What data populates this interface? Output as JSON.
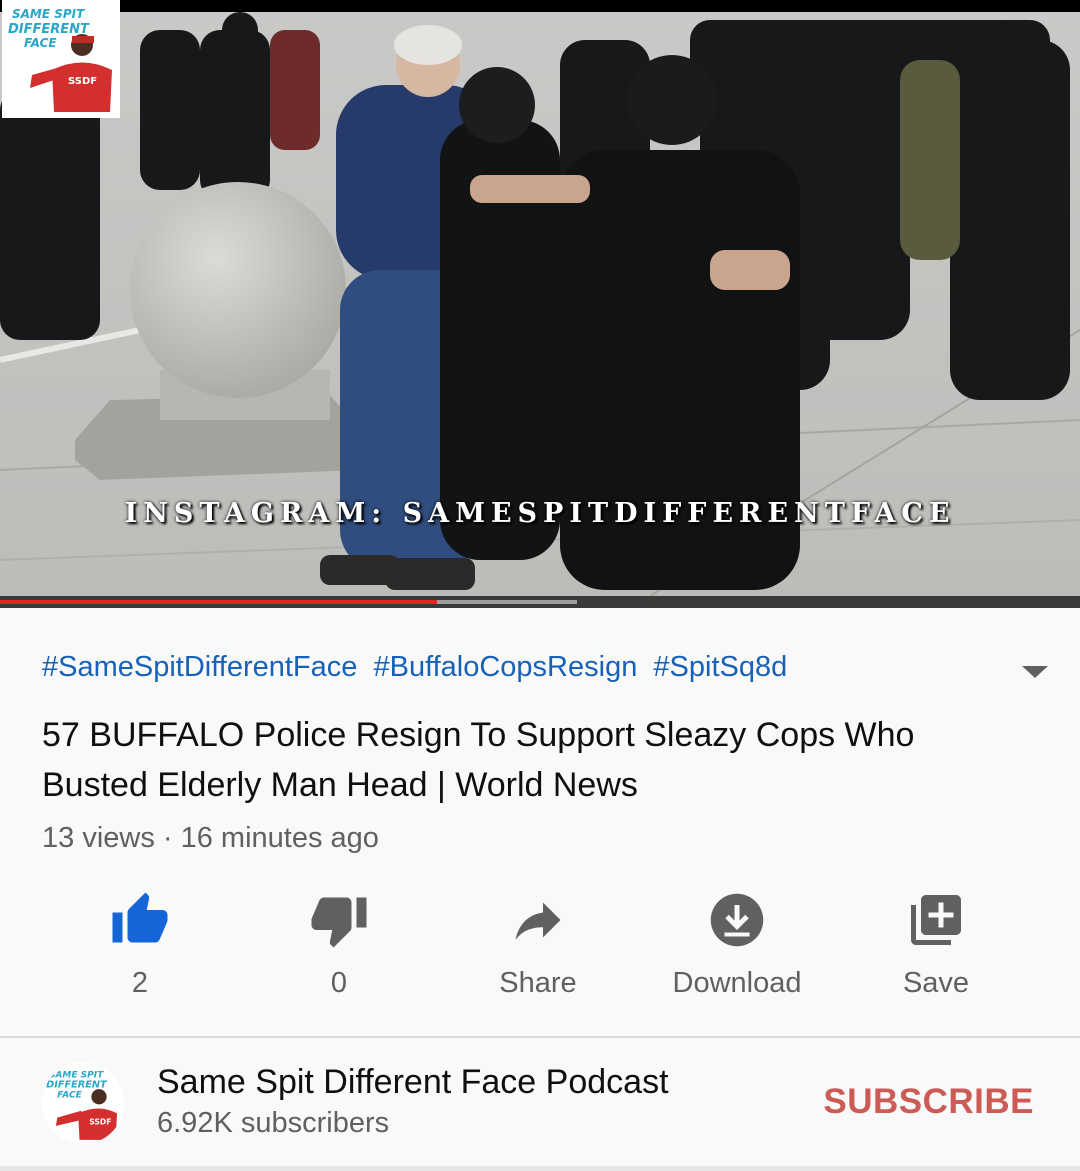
{
  "video": {
    "watermark": "INSTAGRAM: SAMESPITDIFFERENTFACE",
    "logo_text": [
      "SAME SPIT",
      "DIFFERENT",
      "FACE"
    ],
    "logo_badge": "SSDF",
    "progress_fraction": 0.405,
    "buffered_fraction": 0.534
  },
  "hashtags": [
    "#SameSpitDifferentFace",
    "#BuffaloCopsResign",
    "#SpitSq8d"
  ],
  "title": "57 BUFFALO Police Resign To Support Sleazy Cops Who Busted Elderly Man Head | World News",
  "meta": "13 views · 16 minutes ago",
  "actions": {
    "like": {
      "label": "2",
      "icon": "thumbs-up-icon"
    },
    "dislike": {
      "label": "0",
      "icon": "thumbs-down-icon"
    },
    "share": {
      "label": "Share",
      "icon": "share-icon"
    },
    "download": {
      "label": "Download",
      "icon": "download-icon"
    },
    "save": {
      "label": "Save",
      "icon": "add-to-playlist-icon"
    }
  },
  "channel": {
    "name": "Same Spit Different Face Podcast",
    "subscribers": "6.92K subscribers",
    "subscribe_label": "SUBSCRIBE"
  },
  "colors": {
    "link_blue": "#1762b8",
    "like_active_blue": "#1565d8",
    "subscribe_red": "#cc5b55",
    "progress_red": "#e0291f"
  }
}
